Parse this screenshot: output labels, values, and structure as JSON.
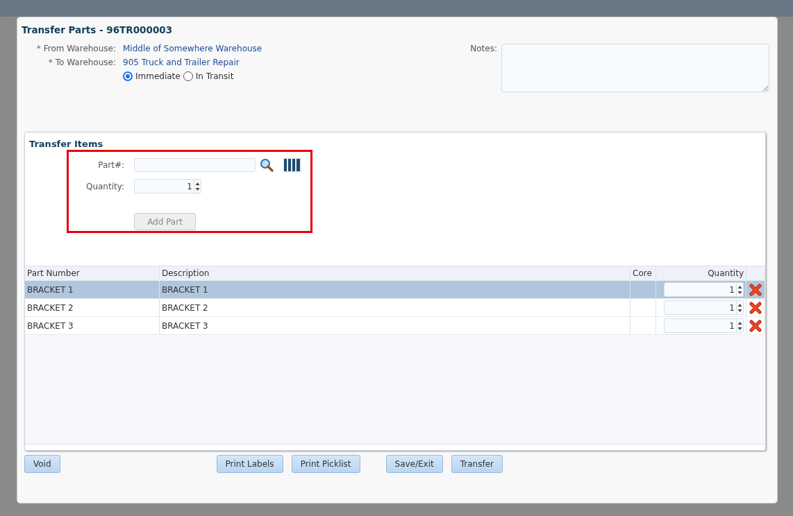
{
  "window": {
    "title": "Transfer Parts - 96TR000003"
  },
  "header": {
    "from_label": "From Warehouse:",
    "from_value": "Middle of Somewhere Warehouse",
    "to_label": "To Warehouse:",
    "to_value": "905 Truck and Trailer Repair",
    "required_mark": "*",
    "transfer_types": [
      {
        "label": "Immediate",
        "selected": true
      },
      {
        "label": "In Transit",
        "selected": false
      }
    ],
    "notes_label": "Notes:"
  },
  "transfer_items": {
    "title": "Transfer Items",
    "highlighted": true,
    "part_label": "Part#:",
    "quantity_label": "Quantity:",
    "quantity_value": "1",
    "add_button": {
      "label": "Add Part",
      "disabled": true
    }
  },
  "table": {
    "columns": [
      "Part Number",
      "Description",
      "Core",
      "Quantity"
    ],
    "rows": [
      {
        "part_number": "BRACKET 1",
        "description": "BRACKET 1",
        "quantity": "1",
        "selected": true
      },
      {
        "part_number": "BRACKET 2",
        "description": "BRACKET 2",
        "quantity": "1",
        "selected": false
      },
      {
        "part_number": "BRACKET 3",
        "description": "BRACKET 3",
        "quantity": "1",
        "selected": false
      }
    ]
  },
  "button_groups": [
    {
      "buttons": [
        "Void"
      ]
    },
    {
      "buttons": [
        "Print Labels",
        "Print Picklist"
      ]
    },
    {
      "buttons": [
        "Save/Exit",
        "Transfer"
      ]
    }
  ]
}
